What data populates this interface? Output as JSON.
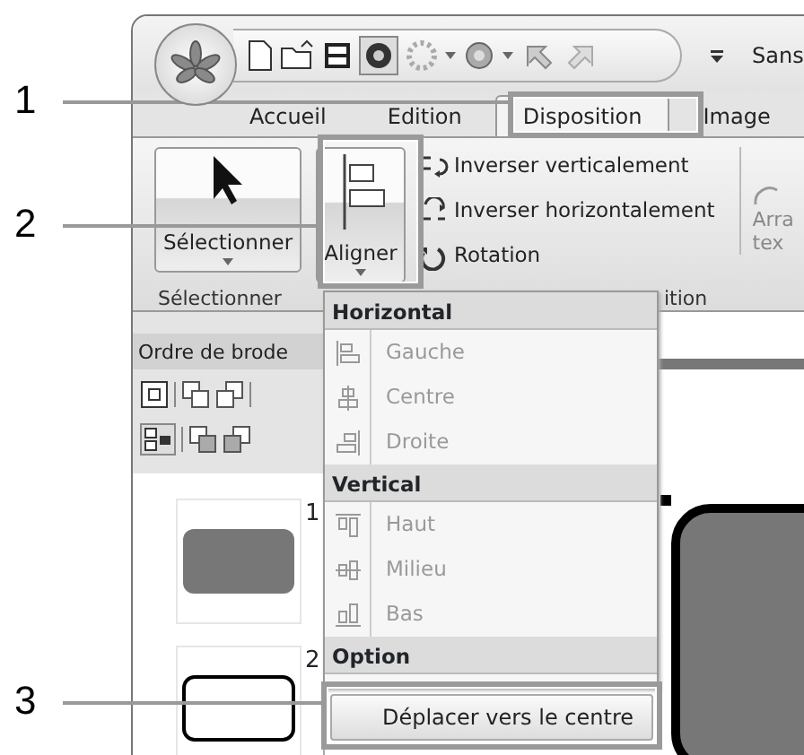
{
  "quick_access": {
    "title": "Sans"
  },
  "tabs": [
    {
      "label": "Accueil",
      "selected": false
    },
    {
      "label": "Edition",
      "selected": false
    },
    {
      "label": "Disposition",
      "selected": true
    },
    {
      "label": "Image",
      "selected": false
    }
  ],
  "ribbon": {
    "large_buttons": [
      {
        "label": "Sélectionner",
        "kind": "select"
      },
      {
        "label": "Aligner",
        "kind": "align"
      }
    ],
    "small_buttons": [
      {
        "label": "Inverser verticalement",
        "kind": "flip-v"
      },
      {
        "label": "Inverser horizontalement",
        "kind": "flip-h"
      },
      {
        "label": "Rotation",
        "kind": "rotate"
      }
    ],
    "cut_button": {
      "lines": [
        "Arra",
        "tex"
      ]
    },
    "groups": [
      "Sélectionner",
      "ition"
    ]
  },
  "side_panel": {
    "title": "Ordre de brode",
    "thumbnails": [
      {
        "number": "1",
        "kind": "filled"
      },
      {
        "number": "2",
        "kind": "outline"
      }
    ]
  },
  "align_menu": {
    "sections": [
      {
        "title": "Horizontal",
        "items": [
          {
            "label": "Gauche",
            "kind": "left",
            "disabled": true
          },
          {
            "label": "Centre",
            "kind": "center",
            "disabled": true
          },
          {
            "label": "Droite",
            "kind": "right",
            "disabled": true
          }
        ]
      },
      {
        "title": "Vertical",
        "items": [
          {
            "label": "Haut",
            "kind": "top",
            "disabled": true
          },
          {
            "label": "Milieu",
            "kind": "middle",
            "disabled": true
          },
          {
            "label": "Bas",
            "kind": "bottom",
            "disabled": true
          }
        ]
      },
      {
        "title": "Option"
      }
    ],
    "button": "Déplacer vers le centre"
  },
  "callouts": [
    {
      "number": "1"
    },
    {
      "number": "2"
    },
    {
      "number": "3"
    }
  ]
}
